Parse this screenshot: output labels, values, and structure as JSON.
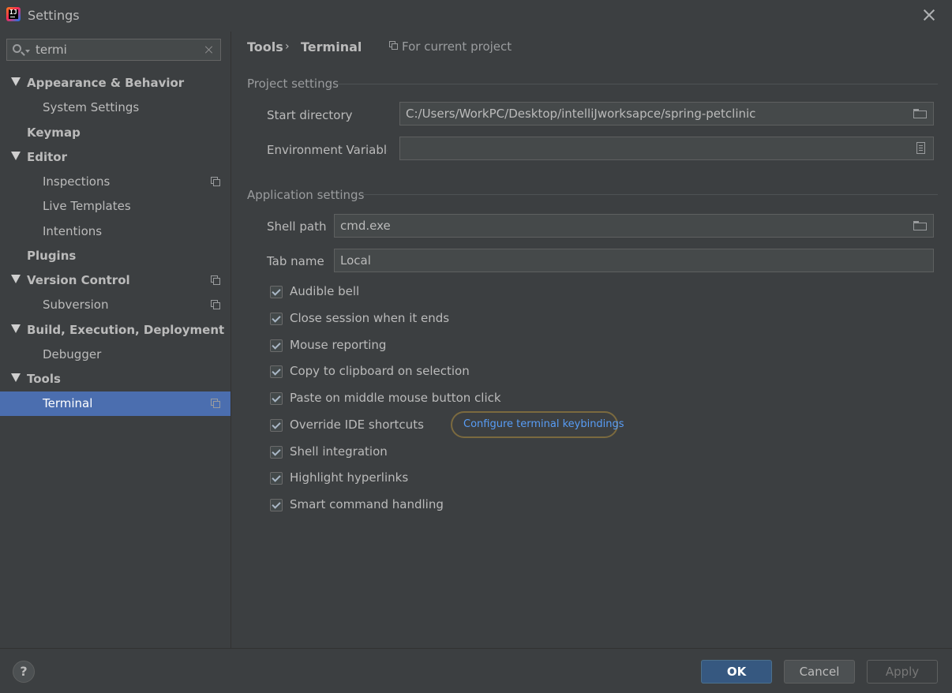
{
  "window": {
    "title": "Settings"
  },
  "search": {
    "value": "termi"
  },
  "sidebar": {
    "items": [
      {
        "label": "Appearance & Behavior"
      },
      {
        "label": "System Settings"
      },
      {
        "label": "Keymap"
      },
      {
        "label": "Editor"
      },
      {
        "label": "Inspections"
      },
      {
        "label": "Live Templates"
      },
      {
        "label": "Intentions"
      },
      {
        "label": "Plugins"
      },
      {
        "label": "Version Control"
      },
      {
        "label": "Subversion"
      },
      {
        "label": "Build, Execution, Deployment"
      },
      {
        "label": "Debugger"
      },
      {
        "label": "Tools"
      },
      {
        "label": "Terminal"
      }
    ]
  },
  "breadcrumb": {
    "parent": "Tools",
    "separator": "›",
    "current": "Terminal",
    "scope": "For current project"
  },
  "project_settings": {
    "title": "Project settings",
    "start_directory": {
      "label": "Start directory",
      "value": "C:/Users/WorkPC/Desktop/intelliJworksapce/spring-petclinic"
    },
    "environment_variables": {
      "label": "Environment Variables",
      "value": ""
    }
  },
  "application_settings": {
    "title": "Application settings",
    "shell_path": {
      "label": "Shell path",
      "value": "cmd.exe"
    },
    "tab_name": {
      "label": "Tab name",
      "value": "Local"
    },
    "checkboxes": [
      {
        "label": "Audible bell",
        "checked": true
      },
      {
        "label": "Close session when it ends",
        "checked": true
      },
      {
        "label": "Mouse reporting",
        "checked": true
      },
      {
        "label": "Copy to clipboard on selection",
        "checked": true
      },
      {
        "label": "Paste on middle mouse button click",
        "checked": true
      },
      {
        "label": "Override IDE shortcuts",
        "checked": true
      },
      {
        "label": "Shell integration",
        "checked": true
      },
      {
        "label": "Highlight hyperlinks",
        "checked": true
      },
      {
        "label": "Smart command handling",
        "checked": true
      }
    ],
    "keybindings_link": "Configure terminal keybindings"
  },
  "footer": {
    "help": "?",
    "ok": "OK",
    "cancel": "Cancel",
    "apply": "Apply"
  },
  "colors": {
    "background": "#3c3f41",
    "selection": "#4b6eaf",
    "link": "#589df6",
    "ok_button": "#365880"
  },
  "icons": [
    "settings-app-icon",
    "close-icon",
    "search-icon",
    "clear-icon",
    "expand-arrow-icon",
    "project-scope-icon",
    "folder-icon",
    "document-icon",
    "help-icon"
  ]
}
